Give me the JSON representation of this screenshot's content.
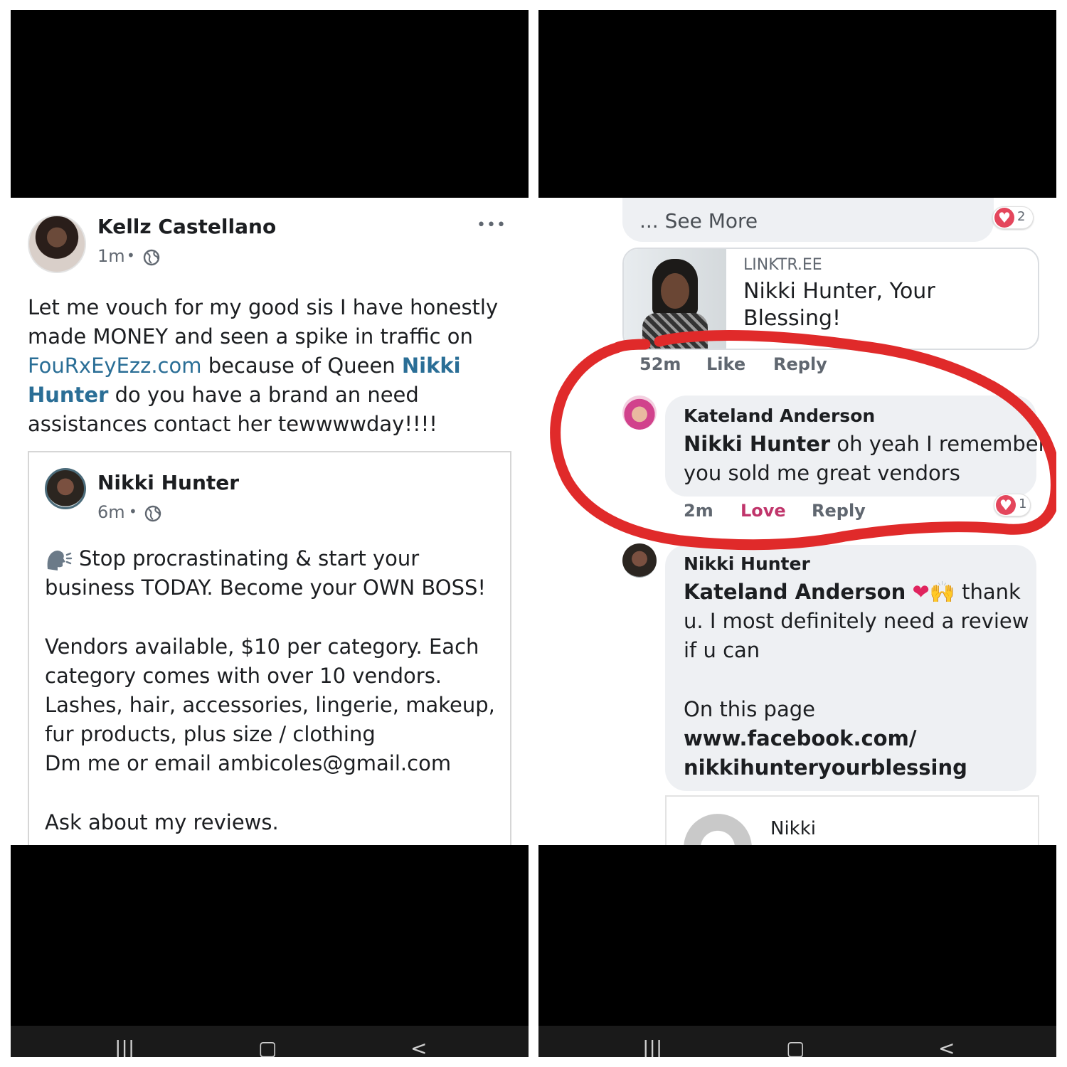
{
  "left": {
    "post_author": "Kellz Castellano",
    "post_time": "1m",
    "dot": "•",
    "globe_icon": "globe-icon",
    "more_label": "•••",
    "body_l1": "Let me vouch for my good sis I have honestly",
    "body_l2": "made MONEY and seen a spike in traffic on",
    "body_l3_link": "FouRxEyEzz.com",
    "body_l3_rest": " because of Queen ",
    "body_l3_mention": "Nikki",
    "body_l4_mention": "Hunter",
    "body_l4_rest": " do you have a brand an need",
    "body_l5": "assistances contact her tewwwwday!!!!",
    "shared": {
      "author": "Nikki Hunter",
      "time": "6m",
      "speaking_icon": "speaking-head-icon",
      "l1": "Stop procrastinating & start your",
      "l2": "business TODAY. Become your OWN BOSS!",
      "l3": "Vendors available, $10 per category. Each",
      "l4": "category comes with over 10 vendors.",
      "l5": "Lashes, hair, accessories, lingerie, makeup,",
      "l6": "fur products, plus size / clothing",
      "l7": "Dm me or email ambicoles@gmail.com",
      "l8": "Ask about my reviews."
    }
  },
  "right": {
    "cut_top_text": "......",
    "see_more": "... See More",
    "reaction1_count": "2",
    "link_card": {
      "domain": "LINKTR.EE",
      "title_l1": "Nikki Hunter, Your",
      "title_l2": "Blessing!"
    },
    "action_row1": {
      "time": "52m",
      "like": "Like",
      "reply": "Reply"
    },
    "comment1": {
      "author": "Kateland Anderson",
      "mention": "Nikki Hunter",
      "text_l1_rest": " oh yeah I remember",
      "text_l2": "you sold me great vendors",
      "time": "2m",
      "love": "Love",
      "reply": "Reply",
      "reaction_count": "1"
    },
    "comment2": {
      "author": "Nikki Hunter",
      "mention": "Kateland Anderson",
      "emoji": "❤🙌",
      "text_l1_rest": " thank",
      "text_l2": "u. I most definitely need a review",
      "text_l3": "if u can",
      "text_l4": "On this page",
      "link_l1": "www.facebook.com/",
      "link_l2": "nikkihunteryourblessing"
    },
    "preview_card": {
      "title": "Nikki"
    }
  },
  "nav": {
    "recent": "|||",
    "home": "▢",
    "back": "<"
  },
  "colors": {
    "link": "#2a6e96",
    "love": "#c0356b",
    "annotation": "#e02a2a",
    "bubble": "#eef0f3"
  }
}
